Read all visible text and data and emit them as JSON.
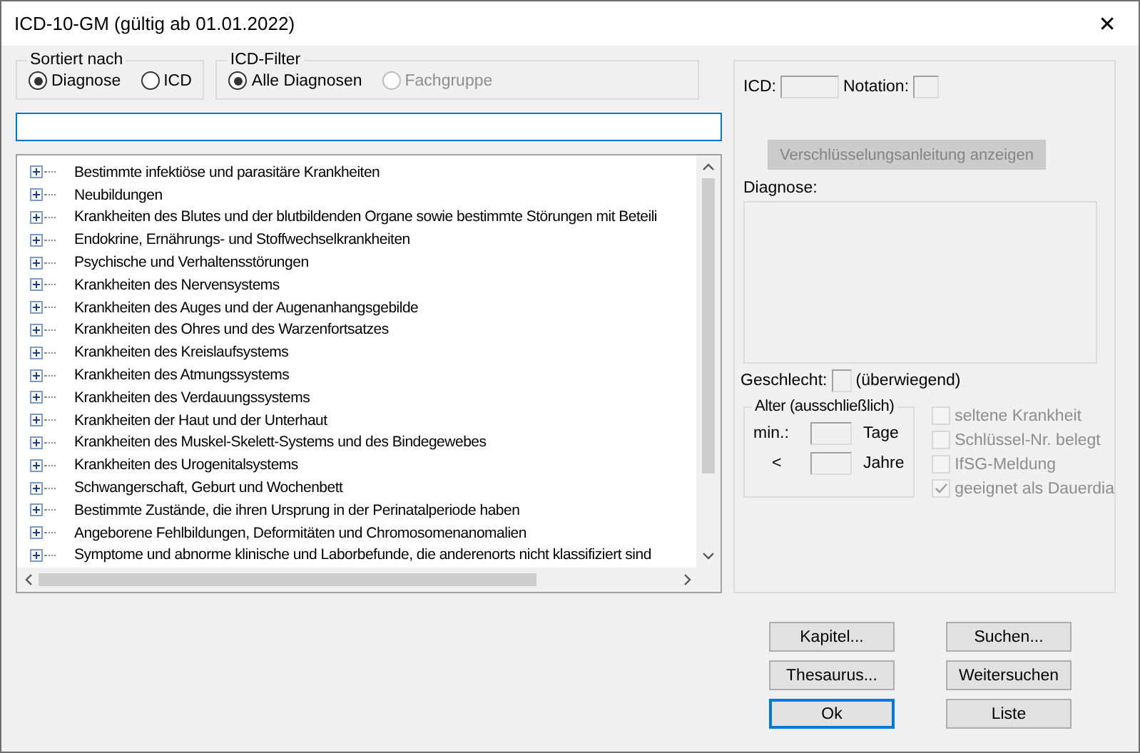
{
  "window": {
    "title": "ICD-10-GM (gültig ab 01.01.2022)",
    "close": "✕"
  },
  "sort": {
    "legend": "Sortiert nach",
    "options": [
      {
        "label": "Diagnose",
        "selected": true,
        "disabled": false
      },
      {
        "label": "ICD",
        "selected": false,
        "disabled": false
      }
    ]
  },
  "filter": {
    "legend": "ICD-Filter",
    "options": [
      {
        "label": "Alle Diagnosen",
        "selected": true,
        "disabled": false
      },
      {
        "label": "Fachgruppe",
        "selected": false,
        "disabled": true
      }
    ]
  },
  "tree": {
    "items": [
      {
        "label": "Bestimmte infektiöse und parasitäre Krankheiten",
        "expanded": false
      },
      {
        "label": "Neubildungen",
        "expanded": false
      },
      {
        "label": "Krankheiten des Blutes und der blutbildenden Organe sowie bestimmte Störungen mit Beteili",
        "expanded": false
      },
      {
        "label": "Endokrine, Ernährungs- und Stoffwechselkrankheiten",
        "expanded": false
      },
      {
        "label": "Psychische und Verhaltensstörungen",
        "expanded": false
      },
      {
        "label": "Krankheiten des Nervensystems",
        "expanded": false
      },
      {
        "label": "Krankheiten des Auges und der Augenanhangsgebilde",
        "expanded": false
      },
      {
        "label": "Krankheiten des Ohres und des Warzenfortsatzes",
        "expanded": false
      },
      {
        "label": "Krankheiten des Kreislaufsystems",
        "expanded": false
      },
      {
        "label": "Krankheiten des Atmungssystems",
        "expanded": false
      },
      {
        "label": "Krankheiten des Verdauungssystems",
        "expanded": false
      },
      {
        "label": "Krankheiten der Haut und der Unterhaut",
        "expanded": false
      },
      {
        "label": "Krankheiten des Muskel-Skelett-Systems und des Bindegewebes",
        "expanded": false
      },
      {
        "label": "Krankheiten des Urogenitalsystems",
        "expanded": false
      },
      {
        "label": "Schwangerschaft, Geburt und Wochenbett",
        "expanded": false
      },
      {
        "label": "Bestimmte Zustände, die ihren Ursprung in der Perinatalperiode haben",
        "expanded": false
      },
      {
        "label": "Angeborene Fehlbildungen, Deformitäten und Chromosomenanomalien",
        "expanded": false
      },
      {
        "label": "Symptome und abnorme klinische und Laborbefunde, die anderenorts nicht klassifiziert sind",
        "expanded": false
      }
    ]
  },
  "details": {
    "icd_label": "ICD:",
    "notation_label": "Notation:",
    "guide_button": {
      "label": "Verschlüsselungsanleitung anzeigen",
      "disabled": true
    },
    "diagnosis_label": "Diagnose:",
    "sex_label": "Geschlecht:",
    "sex_suffix": "(überwiegend)",
    "age": {
      "legend": "Alter (ausschließlich)",
      "min_label": "min.:",
      "min_unit": "Tage",
      "max_label": "<",
      "max_unit": "Jahre"
    },
    "flags": [
      {
        "label": "seltene Krankheit",
        "checked": false,
        "disabled": true
      },
      {
        "label": "Schlüssel-Nr. belegt",
        "checked": false,
        "disabled": true
      },
      {
        "label": "IfSG-Meldung",
        "checked": false,
        "disabled": true
      },
      {
        "label": "geeignet als Dauerdia",
        "checked": true,
        "disabled": true
      }
    ]
  },
  "buttons": [
    {
      "label": "Kapitel...",
      "default": false
    },
    {
      "label": "Suchen...",
      "default": false
    },
    {
      "label": "Thesaurus...",
      "default": false
    },
    {
      "label": "Weitersuchen",
      "default": false
    },
    {
      "label": "Ok",
      "default": true
    },
    {
      "label": "Liste",
      "default": false
    }
  ]
}
